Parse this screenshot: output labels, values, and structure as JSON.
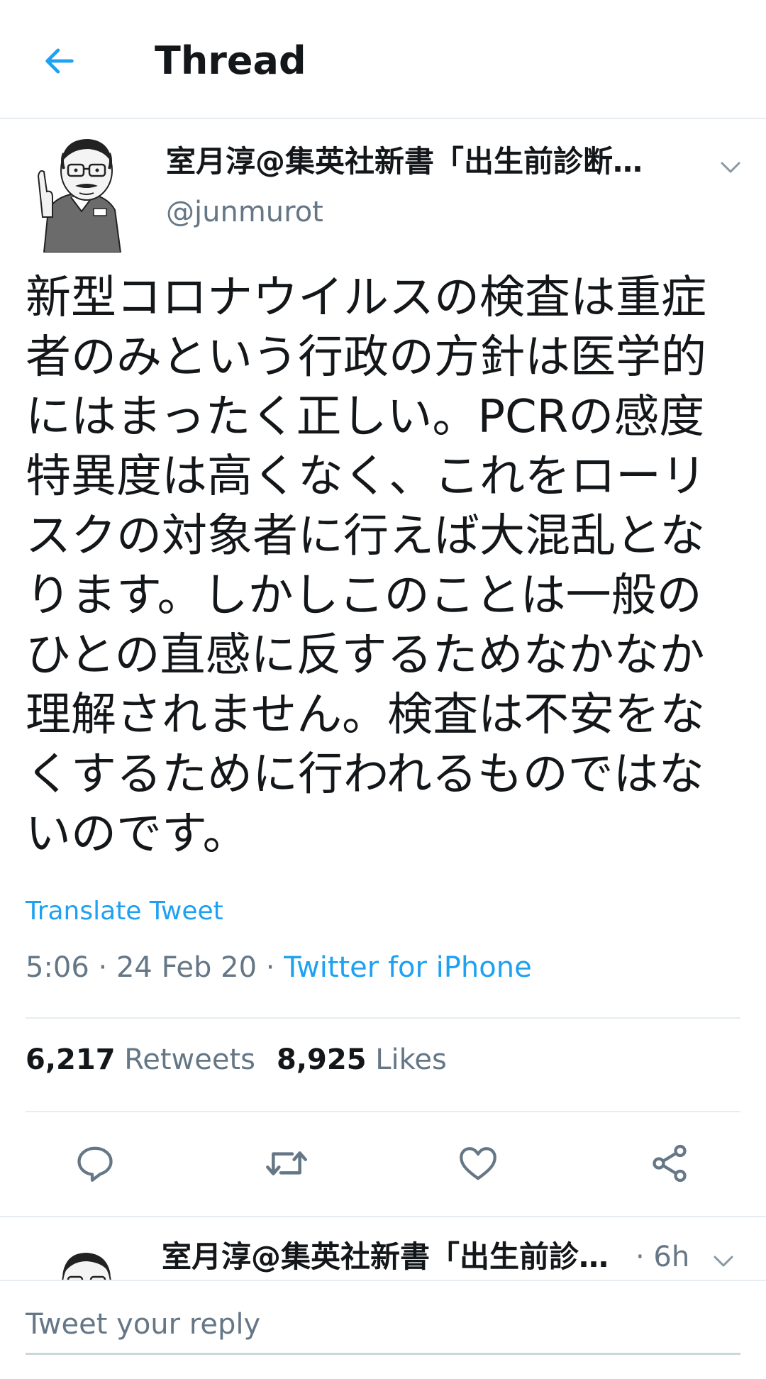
{
  "header": {
    "title": "Thread",
    "back_icon": "arrow-left-icon",
    "accent_color": "#1da1f2"
  },
  "tweet": {
    "author_name": "室月淳@集英社新書「出生前診断…",
    "author_handle": "@junmurot",
    "text": "新型コロナウイルスの検査は重症\n者のみという行政の方針は医学的\nにはまったく正しい。PCRの感度\n特異度は高くなく、これをローリ\nスクの対象者に行えば大混乱とな\nります。しかしこのことは一般の\nひとの直感に反するためなかなか\n理解されません。検査は不安をな\nくするために行われるものではな\nいのです。",
    "translate_label": "Translate Tweet",
    "timestamp": "5:06 · 24 Feb 20 · ",
    "source": "Twitter for iPhone",
    "retweets_count": "6,217",
    "retweets_label": "Retweets",
    "likes_count": "8,925",
    "likes_label": "Likes",
    "actions": [
      "reply-icon",
      "retweet-icon",
      "like-icon",
      "share-icon"
    ]
  },
  "next_tweet": {
    "author_name": "室月淳@集英社新書「出生前診…",
    "time": "· 6h"
  },
  "reply": {
    "placeholder": "Tweet your reply"
  }
}
